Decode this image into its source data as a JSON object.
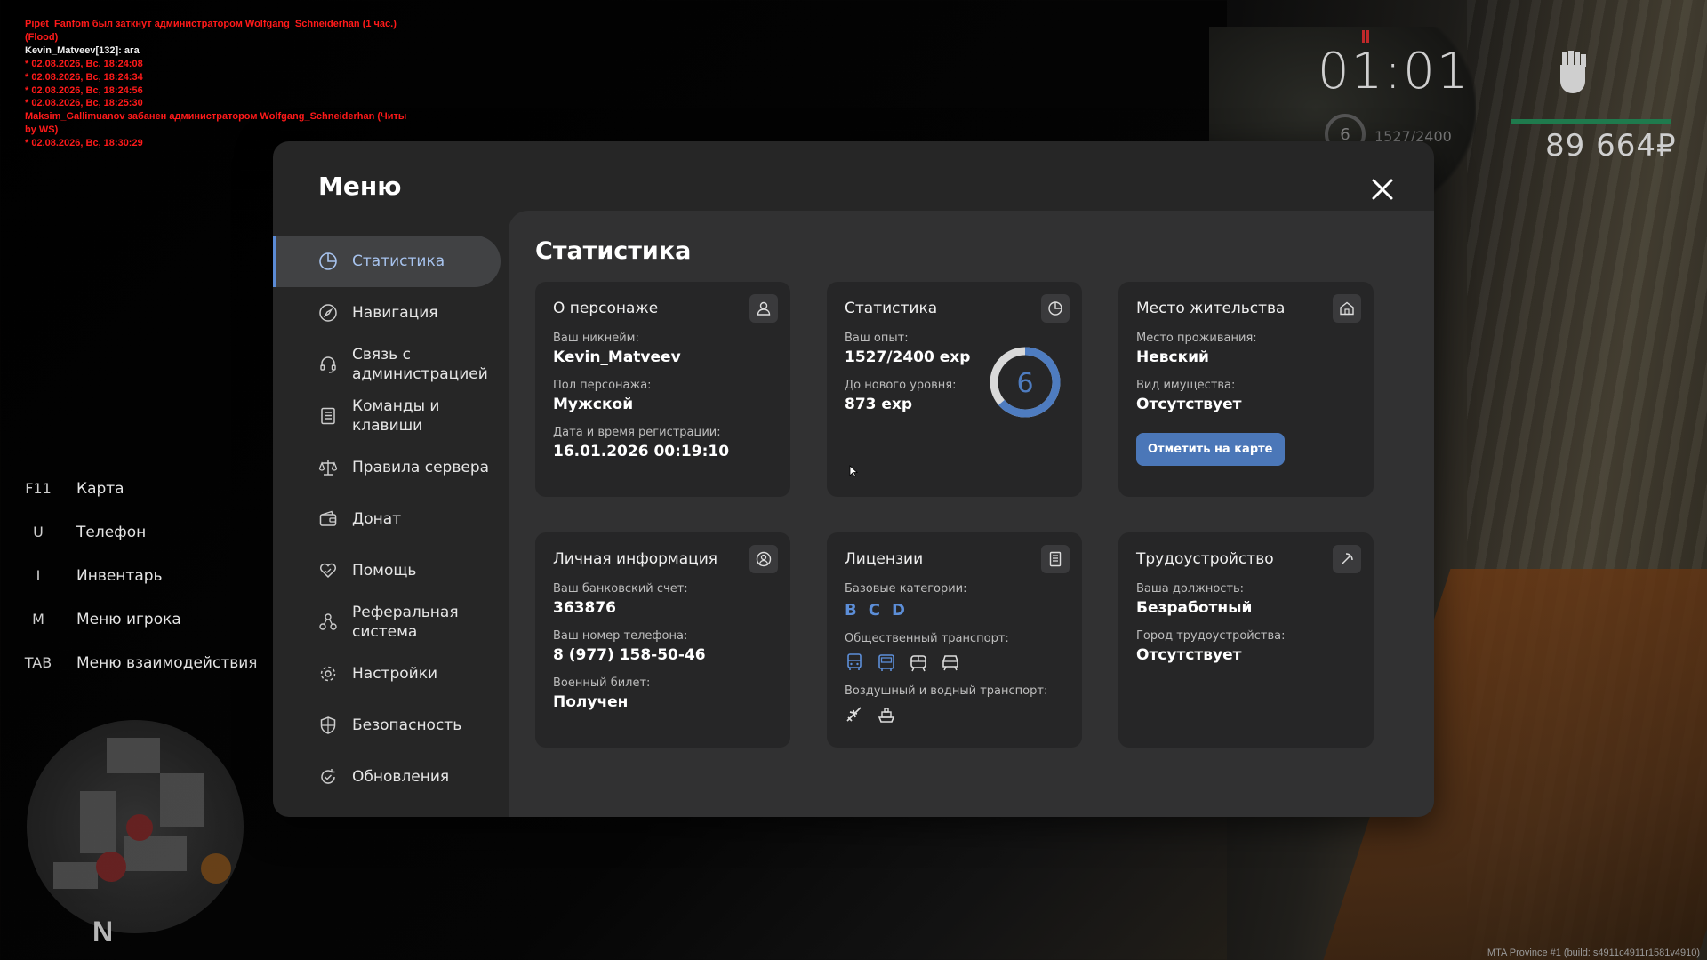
{
  "chat": [
    {
      "text": "Pipet_Fanfom был заткнут администратором Wolfgang_Schneiderhan (1 час.)",
      "color": "red"
    },
    {
      "text": "(Flood)",
      "color": "red"
    },
    {
      "text": "Kevin_Matveev[132]: ага",
      "color": "white"
    },
    {
      "text": "* 02.08.2026, Вс, 18:24:08",
      "color": "red"
    },
    {
      "text": "* 02.08.2026, Вс, 18:24:34",
      "color": "red"
    },
    {
      "text": "* 02.08.2026, Вс, 18:24:56",
      "color": "red"
    },
    {
      "text": "* 02.08.2026, Вс, 18:25:30",
      "color": "red"
    },
    {
      "text": "Maksim_Gallimuanov забанен администратором Wolfgang_Schneiderhan (Читы",
      "color": "red"
    },
    {
      "text": " by WS)",
      "color": "red"
    },
    {
      "text": "* 02.08.2026, Вс, 18:30:29",
      "color": "red"
    }
  ],
  "hud": {
    "time": "01:01",
    "level": "6",
    "exp": "1527/2400",
    "money": "89 664₽",
    "health_color": "#1f7a4d"
  },
  "hotkeys": [
    {
      "key": "F11",
      "label": "Карта"
    },
    {
      "key": "U",
      "label": "Телефон"
    },
    {
      "key": "I",
      "label": "Инвентарь"
    },
    {
      "key": "M",
      "label": "Меню игрока"
    },
    {
      "key": "TAB",
      "label": "Меню взаимодействия"
    }
  ],
  "minimap": {
    "north": "N"
  },
  "build": "MTA Province #1 (build: s4911c4911r1581v4910)",
  "menu": {
    "title": "Меню",
    "sidebar": [
      {
        "label": "Статистика",
        "icon": "pie-chart-icon",
        "active": true
      },
      {
        "label": "Навигация",
        "icon": "compass-icon"
      },
      {
        "label": "Связь с администрацией",
        "icon": "headset-icon"
      },
      {
        "label": "Команды и клавиши",
        "icon": "document-list-icon"
      },
      {
        "label": "Правила сервера",
        "icon": "scales-icon"
      },
      {
        "label": "Донат",
        "icon": "wallet-icon"
      },
      {
        "label": "Помощь",
        "icon": "heart-hand-icon"
      },
      {
        "label": "Реферальная система",
        "icon": "referral-icon"
      },
      {
        "label": "Настройки",
        "icon": "gear-icon"
      },
      {
        "label": "Безопасность",
        "icon": "shield-icon"
      },
      {
        "label": "Обновления",
        "icon": "refresh-check-icon"
      }
    ],
    "content": {
      "title": "Статистика",
      "character": {
        "title": "О персонаже",
        "nick_label": "Ваш никнейм:",
        "nick": "Kevin_Matveev",
        "gender_label": "Пол персонажа:",
        "gender": "Мужской",
        "reg_label": "Дата и время регистрации:",
        "reg": "16.01.2026 00:19:10"
      },
      "stats": {
        "title": "Статистика",
        "exp_label": "Ваш опыт:",
        "exp": "1527/2400 exp",
        "next_label": "До нового уровня:",
        "next": "873 exp",
        "level": "6",
        "progress": 0.636
      },
      "residence": {
        "title": "Место жительства",
        "place_label": "Место проживания:",
        "place": "Невский",
        "property_label": "Вид имущества:",
        "property": "Отсутствует",
        "button": "Отметить на карте"
      },
      "personal": {
        "title": "Личная информация",
        "bank_label": "Ваш банковский счет:",
        "bank": "363876",
        "phone_label": "Ваш номер телефона:",
        "phone": "8 (977) 158-50-46",
        "military_label": "Военный билет:",
        "military": "Получен"
      },
      "licenses": {
        "title": "Лицензии",
        "base_label": "Базовые категории:",
        "categories": [
          "B",
          "C",
          "D"
        ],
        "public_label": "Общественный транспорт:",
        "air_label": "Воздушный и водный транспорт:"
      },
      "employment": {
        "title": "Трудоустройство",
        "position_label": "Ваша должность:",
        "position": "Безработный",
        "city_label": "Город трудоустройства:",
        "city": "Отсутствует"
      }
    }
  },
  "colors": {
    "accent": "#5b8bd6",
    "button": "#4b77b8",
    "chat_red": "#ff1a1a"
  }
}
